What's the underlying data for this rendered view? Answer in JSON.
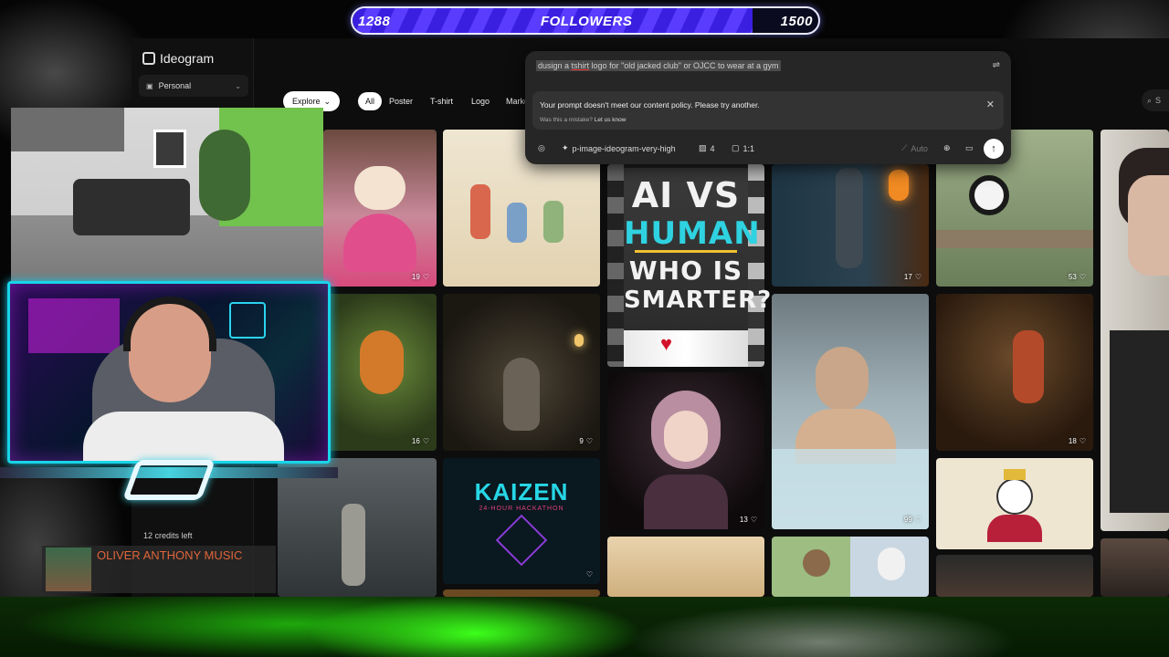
{
  "followers": {
    "current": "1288",
    "label": "FOLLOWERS",
    "goal": "1500",
    "progress": 0.858
  },
  "app": {
    "logo": "Ideogram",
    "workspace": "Personal",
    "credits": "12 credits left",
    "explore_label": "Explore",
    "filters": [
      "All",
      "Poster",
      "T-shirt",
      "Logo",
      "Marke"
    ],
    "search_placeholder": "S"
  },
  "prompt": {
    "before": "dusign a ",
    "typo": "tshirt",
    "after": " logo for \"old jacked club\" or OJCC to wear at a gym",
    "policy_message": "Your prompt doesn't meet our content policy. Please try another.",
    "mistake_question": "Was this a mistake?",
    "mistake_link": "Let us know",
    "model": "p-image-ideogram-very-high",
    "num_images": "4",
    "aspect": "1:1",
    "magic": "Auto"
  },
  "gallery": {
    "likes": [
      "19",
      "16",
      "9",
      "13",
      "99",
      "17",
      "53",
      "18"
    ]
  },
  "thumb": {
    "line1": "AI VS",
    "line2": "HUMAN",
    "line3": "WHO IS",
    "line4": "SMARTER?"
  },
  "kaizen": {
    "title": "KAIZEN",
    "subtitle": "24-HOUR HACKATHON"
  },
  "music": {
    "title": "OLIVER ANTHONY MUSIC"
  },
  "colors": {
    "follow_fill": "#3b1fe0",
    "cam_border": "#19d4e8",
    "splash": "#3cff1a",
    "music_text": "#e0653a"
  }
}
